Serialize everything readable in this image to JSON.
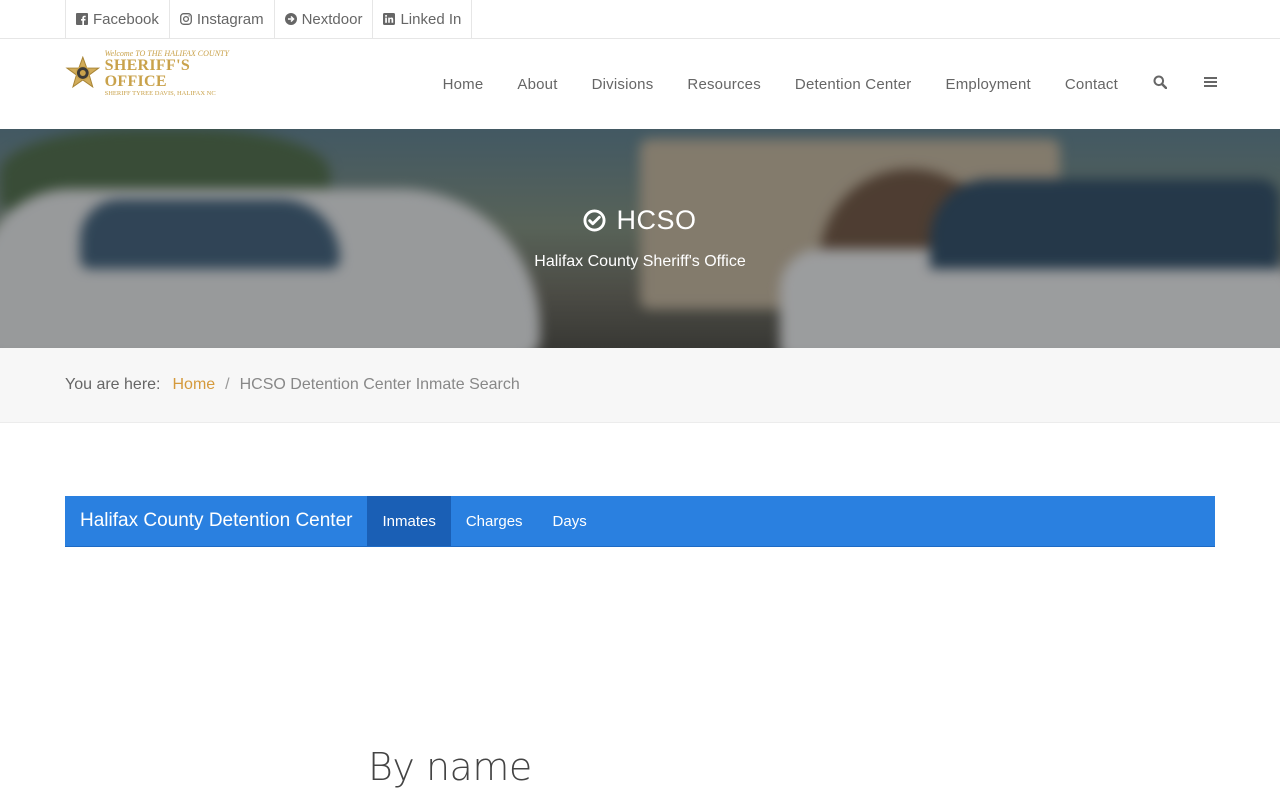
{
  "social": [
    {
      "label": "Facebook",
      "icon": "facebook-icon"
    },
    {
      "label": "Instagram",
      "icon": "instagram-icon"
    },
    {
      "label": "Nextdoor",
      "icon": "nextdoor-icon"
    },
    {
      "label": "Linked In",
      "icon": "linkedin-icon"
    }
  ],
  "logo": {
    "welcome": "Welcome TO THE HALIFAX COUNTY",
    "title": "SHERIFF'S OFFICE",
    "subtitle": "SHERIFF TYREE DAVIS, HALIFAX NC"
  },
  "nav": {
    "items": [
      "Home",
      "About",
      "Divisions",
      "Resources",
      "Detention Center",
      "Employment",
      "Contact"
    ],
    "search_icon": "search-icon",
    "menu_icon": "hamburger-menu-icon"
  },
  "hero": {
    "title": "HCSO",
    "subtitle": "Halifax County Sheriff's Office"
  },
  "breadcrumb": {
    "prefix": "You are here:",
    "home": "Home",
    "separator": "/",
    "current": "HCSO Detention Center Inmate Search"
  },
  "detention_nav": {
    "brand": "Halifax County Detention Center",
    "tabs": [
      "Inmates",
      "Charges",
      "Days"
    ],
    "active_tab": "Inmates"
  },
  "section": {
    "heading": "By name"
  },
  "colors": {
    "accent_blue": "#2a80e0",
    "active_tab": "#1a5fb5",
    "link_gold": "#d59a3c",
    "logo_gold": "#c9a24b"
  }
}
